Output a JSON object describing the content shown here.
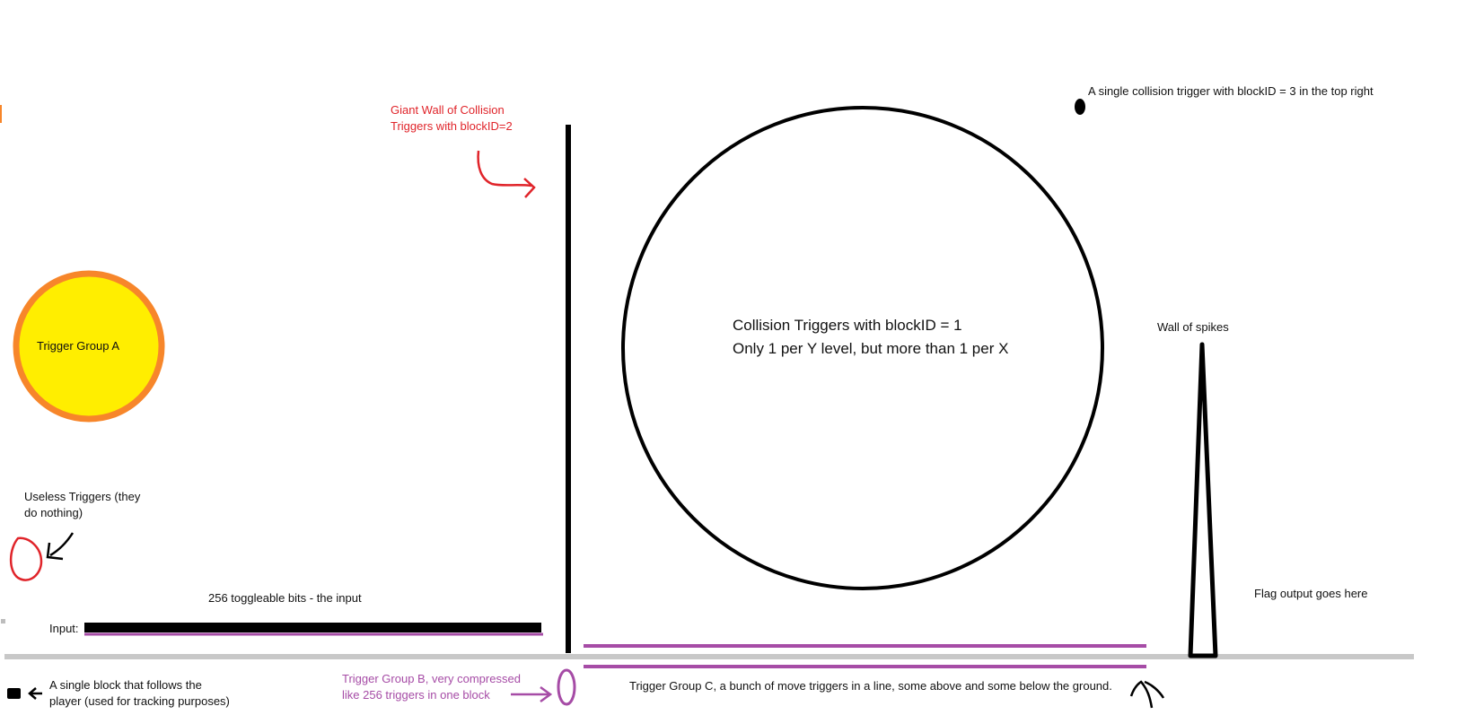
{
  "labels": {
    "wall_title_1": "Giant Wall of Collision",
    "wall_title_2": "Triggers with blockID=2",
    "top_right_trigger": "A single collision trigger with blockID = 3 in the top right",
    "trigger_group_a": "Trigger Group A",
    "circle_line_1": "Collision Triggers with blockID = 1",
    "circle_line_2": "Only 1 per Y level, but more than 1 per X",
    "wall_of_spikes": "Wall of spikes",
    "flag_output": "Flag output goes here",
    "useless_1": "Useless Triggers (they",
    "useless_2": "do nothing)",
    "input_caption": "256 toggleable bits - the input",
    "input_label": "Input:",
    "tracker_1": "A single block that follows the",
    "tracker_2": "player (used for tracking purposes)",
    "group_b_1": "Trigger Group B, very compressed",
    "group_b_2": "like 256 triggers in one block",
    "group_c": "Trigger Group C, a bunch of move triggers in a line, some above and some below the ground."
  },
  "colors": {
    "annotation_red": "#e0242a",
    "annotation_purple": "#a64ca6",
    "group_a_fill": "#ffee00",
    "group_a_ring": "#f7862a",
    "ground": "#c8c8c8",
    "ink": "#000000"
  }
}
